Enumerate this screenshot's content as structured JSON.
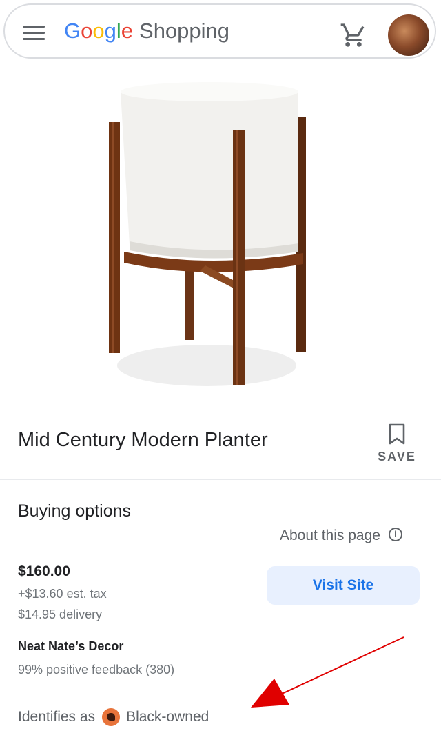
{
  "header": {
    "logo_letters": [
      "G",
      "o",
      "o",
      "g",
      "l",
      "e"
    ],
    "logo_suffix": "Shopping",
    "menu_icon": "menu-icon",
    "cart_icon": "shopping-cart-icon",
    "avatar_icon": "avatar"
  },
  "product": {
    "title": "Mid Century Modern Planter",
    "save_label": "SAVE",
    "image_icon": "planter-image"
  },
  "buying": {
    "heading": "Buying options",
    "about_label": "About this page",
    "info_glyph": "i",
    "price": "$160.00",
    "tax": "+$13.60 est. tax",
    "delivery": "$14.95 delivery",
    "visit_label": "Visit Site",
    "seller_name": "Neat Nate’s Decor",
    "feedback": "99% positive feedback (380)",
    "identifies_prefix": "Identifies as",
    "identifies_label": "Black-owned"
  },
  "colors": {
    "accent_blue": "#1a73e8",
    "button_bg": "#e8f0fe",
    "annotation_red": "#e00000"
  }
}
